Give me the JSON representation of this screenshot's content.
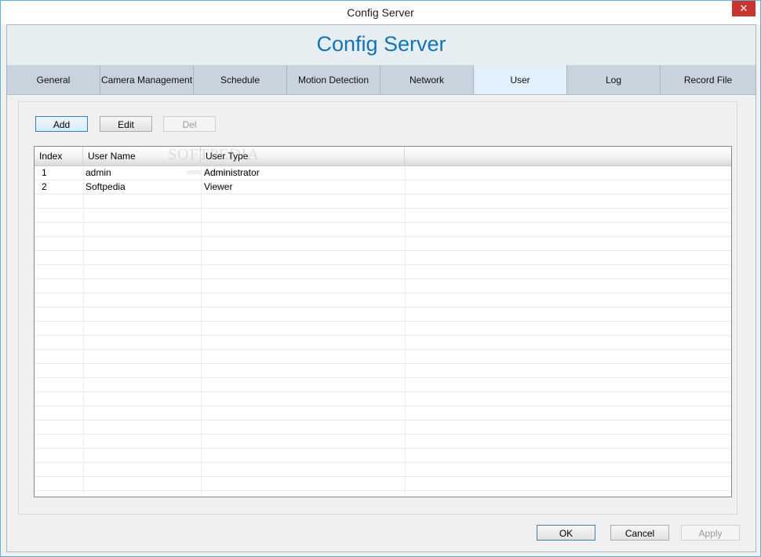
{
  "window": {
    "title": "Config Server",
    "close_glyph": "✕"
  },
  "header": {
    "title": "Config Server"
  },
  "tabs": [
    {
      "label": "General"
    },
    {
      "label": "Camera Management"
    },
    {
      "label": "Schedule"
    },
    {
      "label": "Motion Detection"
    },
    {
      "label": "Network"
    },
    {
      "label": "User",
      "active": true
    },
    {
      "label": "Log"
    },
    {
      "label": "Record File"
    }
  ],
  "toolbar": {
    "add_label": "Add",
    "edit_label": "Edit",
    "del_label": "Del"
  },
  "table": {
    "columns": [
      "Index",
      "User Name",
      "User Type"
    ],
    "rows": [
      {
        "index": "1",
        "user_name": "admin",
        "user_type": "Administrator"
      },
      {
        "index": "2",
        "user_name": "Softpedia",
        "user_type": "Viewer"
      }
    ]
  },
  "watermark": {
    "text": "SOFTPEDIA",
    "sub": "www.softpedia.com"
  },
  "footer": {
    "ok_label": "OK",
    "cancel_label": "Cancel",
    "apply_label": "Apply"
  },
  "colors": {
    "header_title": "#1374b5",
    "active_tab": "#e1f0fb",
    "close_button": "#c7372f"
  }
}
